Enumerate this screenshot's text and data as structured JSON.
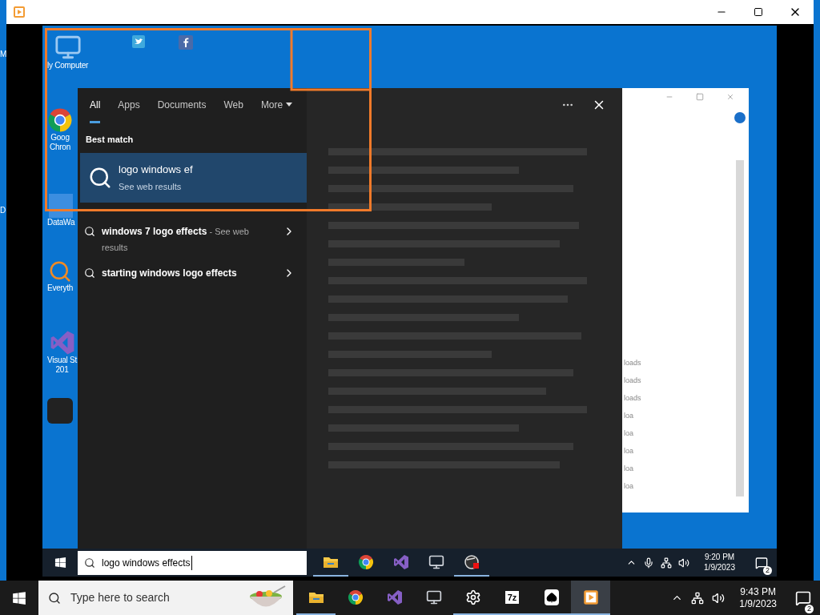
{
  "outer_desktop": {
    "edge_labels": [
      "M",
      "D"
    ]
  },
  "video": {
    "desktop_icons": [
      {
        "kind": "computer",
        "lines": [
          "ly Computer"
        ]
      },
      {
        "kind": "chrome",
        "lines": [
          "Goog",
          "Chron"
        ]
      },
      {
        "kind": "generic",
        "lines": [
          "DataWa"
        ]
      },
      {
        "kind": "everything",
        "lines": [
          "Everyth"
        ]
      },
      {
        "kind": "vs",
        "lines": [
          "Visual St",
          "201"
        ]
      },
      {
        "kind": "dark"
      }
    ],
    "top_icons": [
      {
        "kind": "bird"
      },
      {
        "kind": "f"
      }
    ],
    "search_panel": {
      "tabs": [
        {
          "label": "All",
          "selected": true
        },
        {
          "label": "Apps",
          "selected": false
        },
        {
          "label": "Documents",
          "selected": false
        },
        {
          "label": "Web",
          "selected": false
        },
        {
          "label": "More",
          "selected": false
        }
      ],
      "best_match": {
        "heading": "Best match",
        "title": "logo windows ef",
        "subtitle": "See web results",
        "selected": true
      },
      "suggestions": [
        {
          "query": "windows 7 logo effects",
          "note": "- See web results"
        },
        {
          "query": "starting windows logo effects"
        }
      ]
    },
    "background_window": {
      "labels": [
        "loads",
        "loads",
        "loads",
        "loa",
        "loa",
        "loa",
        "loa",
        "loa"
      ]
    },
    "taskbar": {
      "search": {
        "value": "logo windows effects"
      },
      "apps": [
        {
          "kind": "explorer",
          "running": true,
          "active": false
        },
        {
          "kind": "chrome",
          "running": false,
          "active": false
        },
        {
          "kind": "vs",
          "running": false,
          "active": false
        },
        {
          "kind": "monitor",
          "running": false,
          "active": false
        },
        {
          "kind": "recorder",
          "running": true,
          "active": false
        }
      ],
      "clock": {
        "time": "9:20 PM",
        "date": "1/9/2023"
      },
      "notifications": "2"
    }
  },
  "taskbar": {
    "search": {
      "placeholder": "Type here to search"
    },
    "apps": [
      {
        "kind": "explorer",
        "running": true,
        "active": false
      },
      {
        "kind": "chrome",
        "running": false,
        "active": false
      },
      {
        "kind": "vs",
        "running": false,
        "active": false
      },
      {
        "kind": "monitor",
        "running": false,
        "active": false
      },
      {
        "kind": "gear",
        "running": true,
        "active": false
      },
      {
        "kind": "sevenzip",
        "label": "7z",
        "running": true,
        "active": false
      },
      {
        "kind": "solitaire",
        "running": true,
        "active": false
      },
      {
        "kind": "player",
        "running": true,
        "active": true
      }
    ],
    "clock": {
      "time": "9:43 PM",
      "date": "1/9/2023"
    },
    "notifications": "2"
  }
}
